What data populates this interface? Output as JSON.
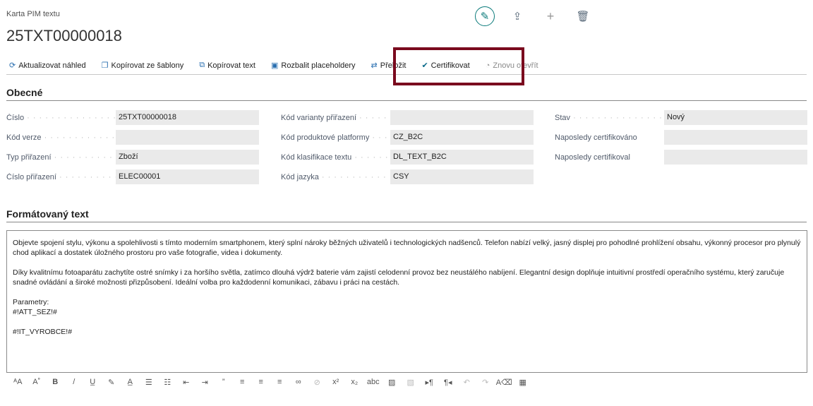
{
  "header": {
    "breadcrumb": "Karta PIM textu",
    "title": "25TXT00000018"
  },
  "header_icons": [
    "edit-icon",
    "share-icon",
    "plus-icon",
    "delete-icon"
  ],
  "actions": [
    {
      "label": "Aktualizovat náhled",
      "icon": "refresh-icon",
      "glyph": "⟳",
      "disabled": false
    },
    {
      "label": "Kopírovat ze šablony",
      "icon": "copy-template-icon",
      "glyph": "❐",
      "disabled": false
    },
    {
      "label": "Kopírovat text",
      "icon": "copy-text-icon",
      "glyph": "⧉",
      "disabled": false
    },
    {
      "label": "Rozbalit placeholdery",
      "icon": "expand-placeholders-icon",
      "glyph": "▣",
      "disabled": false
    },
    {
      "label": "Přeložit",
      "icon": "translate-icon",
      "glyph": "⇄",
      "disabled": false
    },
    {
      "label": "Certifikovat",
      "icon": "check-icon",
      "glyph": "✔",
      "disabled": false
    },
    {
      "label": "Znovu otevřít",
      "icon": "reopen-icon",
      "glyph": "◔",
      "disabled": true
    }
  ],
  "general": {
    "title": "Obecné",
    "col1": [
      {
        "label": "Číslo",
        "value": "25TXT00000018"
      },
      {
        "label": "Kód verze",
        "value": ""
      },
      {
        "label": "Typ přiřazení",
        "value": "Zboží"
      },
      {
        "label": "Číslo přiřazení",
        "value": "ELEC00001"
      }
    ],
    "col2": [
      {
        "label": "Kód varianty přiřazení",
        "value": ""
      },
      {
        "label": "Kód produktové platformy",
        "value": "CZ_B2C"
      },
      {
        "label": "Kód klasifikace textu",
        "value": "DL_TEXT_B2C"
      },
      {
        "label": "Kód jazyka",
        "value": "CSY"
      }
    ],
    "col3": [
      {
        "label": "Stav",
        "value": "Nový"
      },
      {
        "label": "Naposledy certifikováno",
        "value": ""
      },
      {
        "label": "Naposledy certifikoval",
        "value": ""
      }
    ]
  },
  "formatted": {
    "title": "Formátovaný text",
    "paragraphs": [
      "Objevte spojení stylu, výkonu a spolehlivosti s tímto moderním smartphonem, který splní nároky běžných uživatelů i technologických nadšenců. Telefon nabízí velký, jasný displej pro pohodlné prohlížení obsahu, výkonný procesor pro plynulý chod aplikací a dostatek úložného prostoru pro vaše fotografie, videa i dokumenty.",
      "Díky kvalitnímu fotoaparátu zachytíte ostré snímky i za horšího světla, zatímco dlouhá výdrž baterie vám zajistí celodenní provoz bez neustálého nabíjení. Elegantní design doplňuje intuitivní prostředí operačního systému, který zaručuje snadné ovládání a široké možnosti přizpůsobení. Ideální volba pro každodenní komunikaci, zábavu i práci na cestách.",
      "Parametry:\n#!ATT_SEZ!#",
      "#!IT_VYROBCE!#"
    ]
  },
  "toolbar": [
    {
      "icon": "font-size-icon",
      "glyph": "ᴬA"
    },
    {
      "icon": "font-grow-icon",
      "glyph": "A˚"
    },
    {
      "icon": "bold-icon",
      "glyph": "B"
    },
    {
      "icon": "italic-icon",
      "glyph": "/"
    },
    {
      "icon": "underline-icon",
      "glyph": "U̲"
    },
    {
      "icon": "highlight-icon",
      "glyph": "✎"
    },
    {
      "icon": "font-color-icon",
      "glyph": "A̲"
    },
    {
      "icon": "bullet-list-icon",
      "glyph": "☰"
    },
    {
      "icon": "numbered-list-icon",
      "glyph": "☷"
    },
    {
      "icon": "outdent-icon",
      "glyph": "⇤"
    },
    {
      "icon": "indent-icon",
      "glyph": "⇥"
    },
    {
      "icon": "quote-icon",
      "glyph": "”"
    },
    {
      "icon": "align-left-icon",
      "glyph": "≡"
    },
    {
      "icon": "align-center-icon",
      "glyph": "≡"
    },
    {
      "icon": "align-right-icon",
      "glyph": "≡"
    },
    {
      "icon": "link-icon",
      "glyph": "∞"
    },
    {
      "icon": "unlink-icon",
      "glyph": "⊘"
    },
    {
      "icon": "superscript-icon",
      "glyph": "x²"
    },
    {
      "icon": "subscript-icon",
      "glyph": "x₂"
    },
    {
      "icon": "strikethrough-icon",
      "glyph": "abc"
    },
    {
      "icon": "image-icon",
      "glyph": "▨"
    },
    {
      "icon": "image-edit-icon",
      "glyph": "▧"
    },
    {
      "icon": "ltr-icon",
      "glyph": "▸¶"
    },
    {
      "icon": "rtl-icon",
      "glyph": "¶◂"
    },
    {
      "icon": "undo-icon",
      "glyph": "↶"
    },
    {
      "icon": "redo-icon",
      "glyph": "↷"
    },
    {
      "icon": "clear-format-icon",
      "glyph": "A⌫"
    },
    {
      "icon": "table-icon",
      "glyph": "▦"
    }
  ]
}
